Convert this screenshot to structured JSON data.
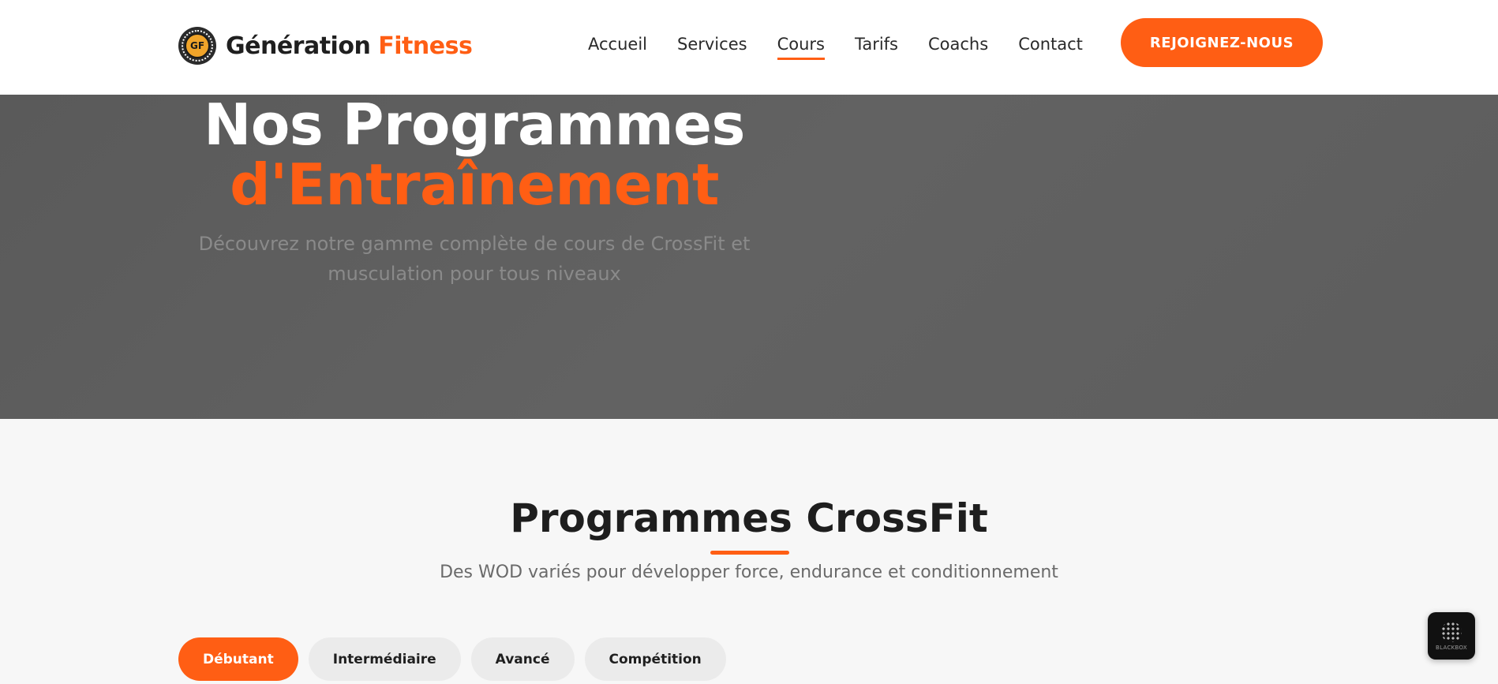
{
  "header": {
    "logo": {
      "badge_text": "GF",
      "name_main": "Génération",
      "name_accent": "Fitness"
    },
    "nav": [
      {
        "label": "Accueil"
      },
      {
        "label": "Services"
      },
      {
        "label": "Cours",
        "active": true
      },
      {
        "label": "Tarifs"
      },
      {
        "label": "Coachs"
      },
      {
        "label": "Contact"
      }
    ],
    "cta_label": "REJOIGNEZ-NOUS"
  },
  "hero": {
    "title_line1": "Nos Programmes",
    "title_line2": "d'Entraînement",
    "subtitle": "Découvrez notre gamme complète de cours de CrossFit et musculation pour tous niveaux"
  },
  "section": {
    "title": "Programmes CrossFit",
    "subtitle": "Des WOD variés pour développer force, endurance et conditionnement",
    "tabs": [
      {
        "label": "Débutant",
        "active": true
      },
      {
        "label": "Intermédiaire"
      },
      {
        "label": "Avancé"
      },
      {
        "label": "Compétition"
      }
    ]
  },
  "widget": {
    "label": "BLACKBOX",
    "icon": "blackbox-logo-icon"
  },
  "colors": {
    "accent": "#ff5e14",
    "hero_bg": "#5f5f5f",
    "page_bg": "#f7f7f7"
  }
}
